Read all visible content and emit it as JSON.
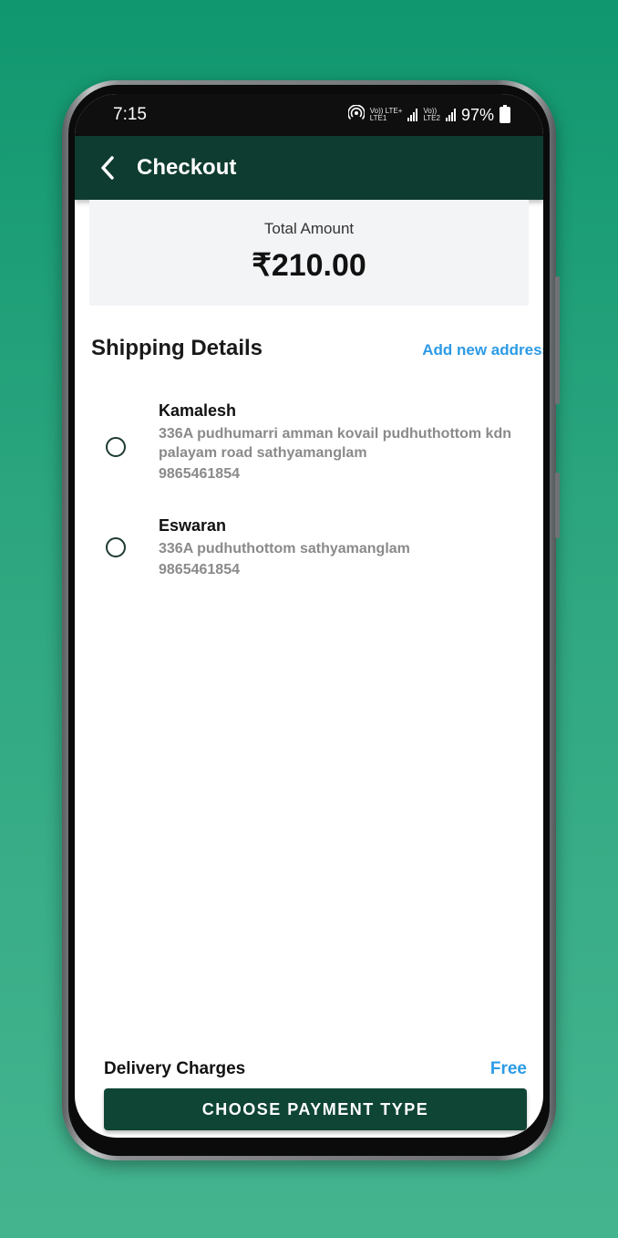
{
  "status_bar": {
    "time": "7:15",
    "network_label_1": "Vo)) LTE+",
    "network_sub_1": "LTE1",
    "network_label_2": "Vo))",
    "network_sub_2": "LTE2",
    "battery": "97%"
  },
  "app_bar": {
    "title": "Checkout"
  },
  "total": {
    "label": "Total Amount",
    "amount": "₹210.00"
  },
  "shipping": {
    "title": "Shipping Details",
    "add_link": "Add new address",
    "addresses": [
      {
        "name": "Kamalesh",
        "line": "336A pudhumarri amman kovail pudhuthottom kdn palayam road sathyamanglam",
        "phone": "9865461854"
      },
      {
        "name": "Eswaran",
        "line": "336A pudhuthottom sathyamanglam",
        "phone": "9865461854"
      }
    ]
  },
  "delivery": {
    "label": "Delivery Charges",
    "value": "Free"
  },
  "pay_button": {
    "label": "CHOOSE PAYMENT TYPE"
  }
}
